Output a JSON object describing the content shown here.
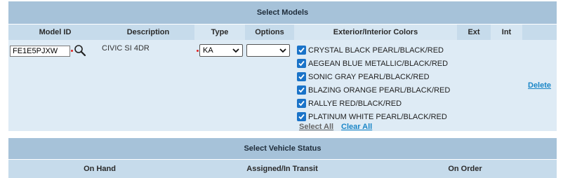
{
  "models_panel": {
    "title": "Select Models",
    "columns": [
      "Model ID",
      "Description",
      "Type",
      "Options",
      "Exterior/Interior Colors",
      "Ext",
      "Int"
    ],
    "row": {
      "model_id": "FE1E5PJXW",
      "description": "CIVIC SI 4DR",
      "type_selected": "KA",
      "options_selected": "",
      "colors": [
        {
          "label": "CRYSTAL BLACK PEARL/BLACK/RED",
          "checked": true
        },
        {
          "label": "AEGEAN BLUE METALLIC/BLACK/RED",
          "checked": true
        },
        {
          "label": "SONIC GRAY PEARL/BLACK/RED",
          "checked": true
        },
        {
          "label": "BLAZING ORANGE PEARL/BLACK/RED",
          "checked": true
        },
        {
          "label": "RALLYE RED/BLACK/RED",
          "checked": true
        },
        {
          "label": "PLATINUM WHITE PEARL/BLACK/RED",
          "checked": true
        }
      ],
      "select_all": "Select All",
      "clear_all": "Clear All",
      "delete": "Delete"
    }
  },
  "status_panel": {
    "title": "Select Vehicle Status",
    "columns": [
      "On Hand",
      "Assigned/In Transit",
      "On Order"
    ]
  },
  "colors": {
    "header_dark": "#a6c2d9",
    "header_light": "#c6dbeb",
    "row_bg": "#deebf5",
    "link_blue": "#1a86c7",
    "checkbox_blue": "#1a73c8"
  }
}
